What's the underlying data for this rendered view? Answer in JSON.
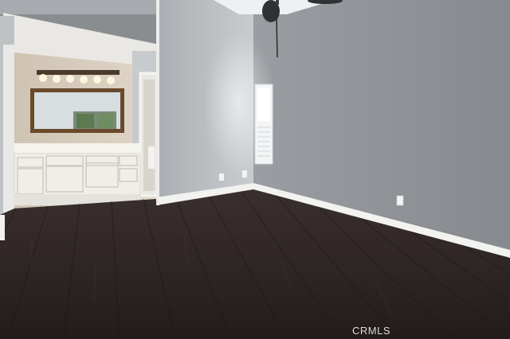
{
  "photo": {
    "watermark": "CRMLS"
  },
  "palette": {
    "wall_right": "#8f9397",
    "wall_left": "#a3a7ab",
    "floor": "#2a2221",
    "baseboard": "#f2f2f0",
    "bath_wall": "#d9cfc0",
    "cabinet": "#f3f1ec",
    "mirror_frame": "#6a4a2c",
    "ceiling": "#eef0f1"
  }
}
